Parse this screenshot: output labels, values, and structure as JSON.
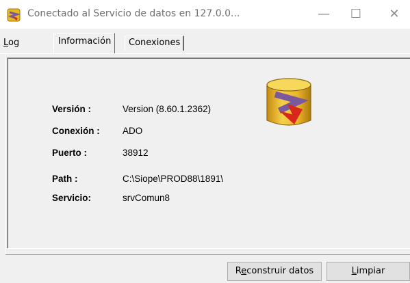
{
  "window": {
    "title": "Conectado al Servicio de datos en 127.0.0...",
    "minimize_glyph": "—",
    "maximize_glyph": "☐",
    "close_glyph": "✕"
  },
  "tabs": [
    {
      "label_pre": "",
      "label_mn": "L",
      "label_post": "og"
    },
    {
      "label": "Información"
    },
    {
      "label": "Conexiones"
    }
  ],
  "info": {
    "version_label": "Versión :",
    "version_value": "Version (8.60.1.2362)",
    "connection_label": "Conexión :",
    "connection_value": "ADO",
    "port_label": "Puerto :",
    "port_value": "38912",
    "path_label": "Path :",
    "path_value": "C:\\Siope\\PROD88\\1891\\",
    "service_label": "Servicio:",
    "service_value": "srvComun8"
  },
  "buttons": {
    "rebuild_pre": "R",
    "rebuild_mn": "e",
    "rebuild_post": "construir datos",
    "clear_pre": "",
    "clear_mn": "L",
    "clear_post": "impiar"
  },
  "colors": {
    "icon_gold": "#e8b81c",
    "icon_red": "#d8281c",
    "icon_purple": "#7a5a9c"
  },
  "icons": {
    "app": "database-app-icon",
    "logo": "database-logo-icon"
  }
}
